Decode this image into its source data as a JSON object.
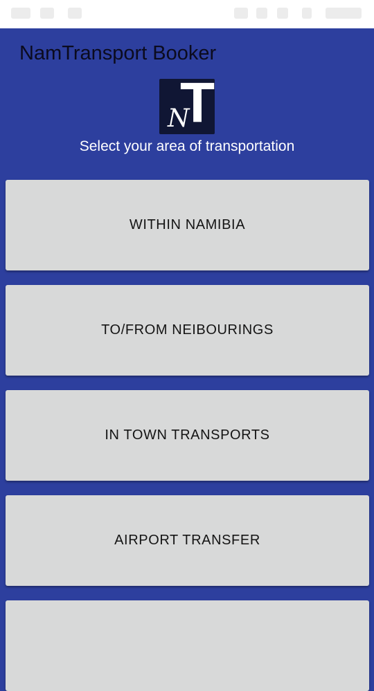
{
  "app": {
    "title": "NamTransport Booker",
    "subtitle": "Select your area of transportation",
    "logo_letters": {
      "small": "N",
      "big": "T"
    }
  },
  "options": [
    {
      "label": "WITHIN NAMIBIA"
    },
    {
      "label": "TO/FROM NEIBOURINGS"
    },
    {
      "label": "IN TOWN TRANSPORTS"
    },
    {
      "label": "AIRPORT TRANSFER"
    },
    {
      "label": ""
    }
  ],
  "colors": {
    "primary": "#2d3f9e",
    "button_bg": "#d8d9d9",
    "title_text": "#0b0b1e",
    "logo_bg": "#101634"
  }
}
